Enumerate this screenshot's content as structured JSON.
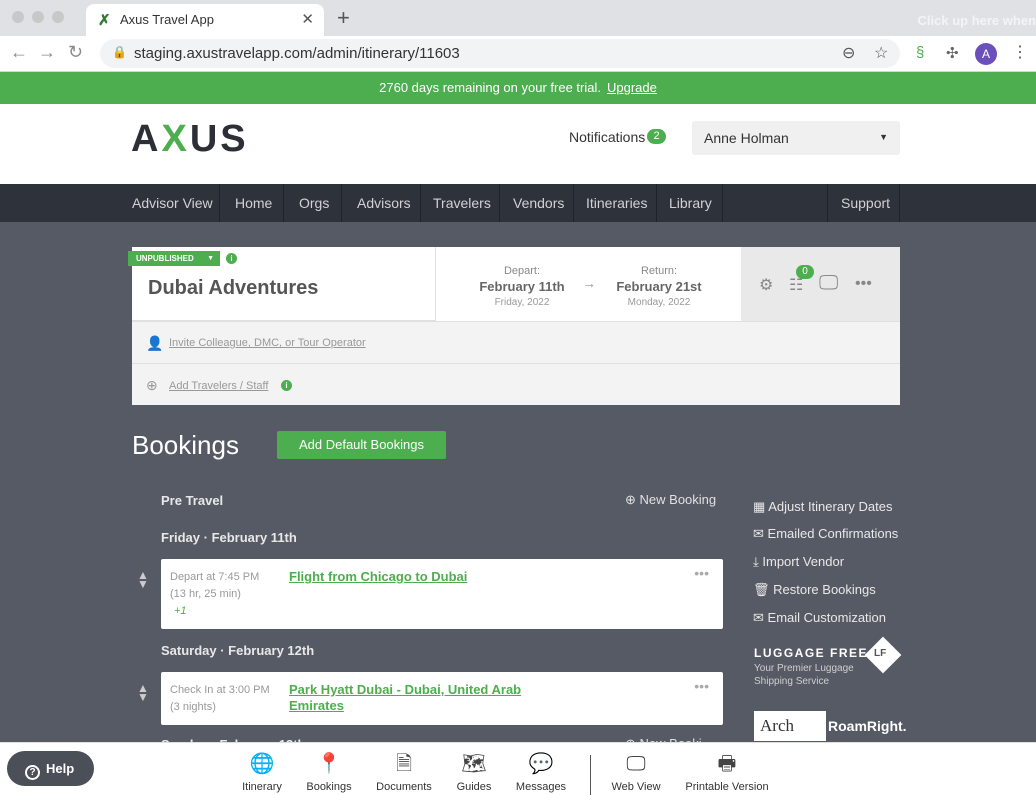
{
  "browser": {
    "tab_title": "Axus Travel App",
    "new_tab_icon": "plus-icon",
    "faded_hint": "Click up here when",
    "url": "staging.axustravelapp.com/admin/itinerary/11603",
    "avatar_letter": "A"
  },
  "trial_banner": {
    "message": "2760 days remaining on your free trial.",
    "upgrade_link": "Upgrade",
    "color": "#4cae4f"
  },
  "header": {
    "logo_left": "A",
    "logo_x": "X",
    "logo_right": "US",
    "notifications_label": "Notifications",
    "notifications_count": "2",
    "user_name": "Anne Holman"
  },
  "nav": {
    "items": [
      "Advisor View",
      "Home",
      "Orgs",
      "Advisors",
      "Travelers",
      "Vendors",
      "Itineraries",
      "Library"
    ],
    "support": "Support"
  },
  "itinerary": {
    "status": "UNPUBLISHED",
    "title": "Dubai Adventures",
    "depart_label": "Depart:",
    "depart_date": "February 11th",
    "depart_sub": "Friday, 2022",
    "return_label": "Return:",
    "return_date": "February 21st",
    "return_sub": "Monday, 2022",
    "checklist_count": "0",
    "invite_link": "Invite Colleague, DMC, or Tour Operator",
    "add_travelers_link": "Add Travelers / Staff"
  },
  "bookings": {
    "title": "Bookings",
    "add_default_button": "Add Default Bookings",
    "new_booking": "New Booking",
    "new_booking_cutoff": "New Booki",
    "sections": {
      "pre_travel": "Pre Travel",
      "day1": "Friday · February 11th",
      "day2": "Saturday · February 12th",
      "day3_cutoff": "Sunday · February 13th"
    },
    "items": [
      {
        "meta1": "Depart at 7:45 PM",
        "meta2": "(13 hr, 25 min)",
        "meta3": "+1",
        "title_line1": "Flight from Chicago to Dubai",
        "title_line2": ""
      },
      {
        "meta1": "Check In at 3:00 PM",
        "meta2": "(3 nights)",
        "meta3": "",
        "title_line1": "Park Hyatt Dubai - Dubai, United Arab",
        "title_line2": "Emirates"
      }
    ]
  },
  "side_actions": [
    "Adjust Itinerary Dates",
    "Emailed Confirmations",
    "Import Vendor",
    "Restore Bookings",
    "Email Customization"
  ],
  "partners": {
    "luggage_free_title": "LUGGAGE FREE",
    "luggage_free_sub1": "Your Premier Luggage",
    "luggage_free_sub2": "Shipping Service",
    "luggage_free_badge": "LF",
    "arch": "Arch",
    "roamright": "RoamRight."
  },
  "toolbar": {
    "help": "Help",
    "items": [
      "Itinerary",
      "Bookings",
      "Documents",
      "Guides",
      "Messages"
    ],
    "web_view": "Web View",
    "printable": "Printable Version"
  }
}
